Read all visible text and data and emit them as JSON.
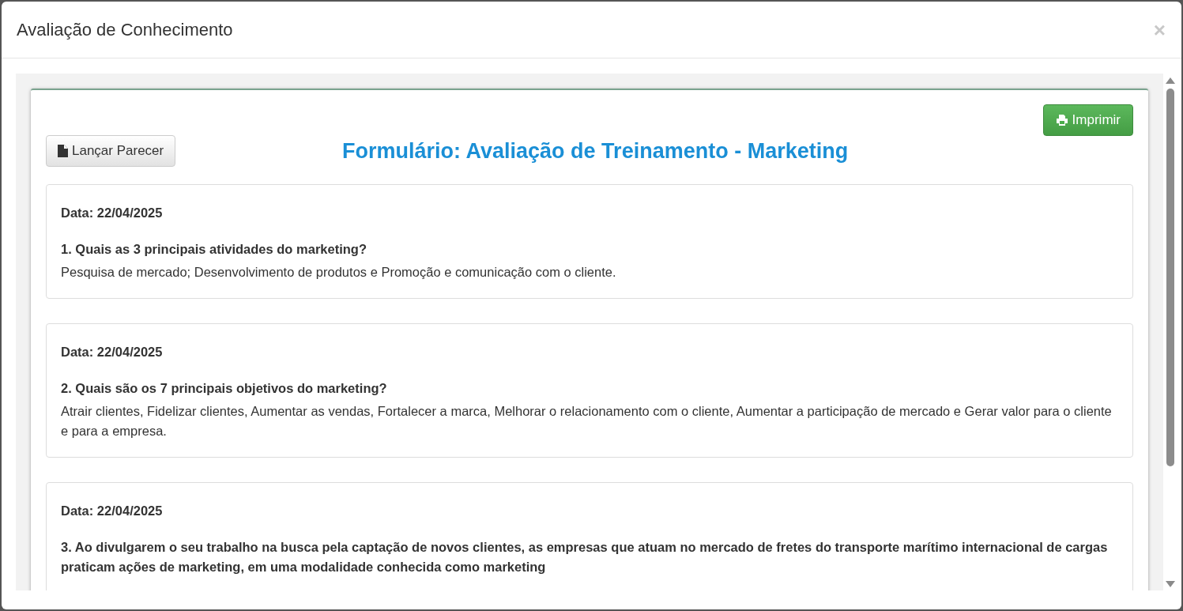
{
  "modal": {
    "title": "Avaliação de Conhecimento",
    "close": "×"
  },
  "actions": {
    "print_button": "Imprimir",
    "opinion_button": "Lançar Parecer"
  },
  "form_title": "Formulário: Avaliação de Treinamento - Marketing",
  "questions": [
    {
      "date": "Data: 22/04/2025",
      "question": "1. Quais as 3 principais atividades do marketing?",
      "answer": "Pesquisa de mercado; Desenvolvimento de produtos e Promoção e comunicação com o cliente."
    },
    {
      "date": "Data: 22/04/2025",
      "question": "2. Quais são os 7 principais objetivos do marketing?",
      "answer": "Atrair clientes, Fidelizar clientes, Aumentar as vendas, Fortalecer a marca, Melhorar o relacionamento com o cliente, Aumentar a participação de mercado e Gerar valor para o cliente e para a empresa."
    },
    {
      "date": "Data: 22/04/2025",
      "question": "3. Ao divulgarem o seu trabalho na busca pela captação de novos clientes, as empresas que atuam no mercado de fretes do transporte marítimo internacional de cargas praticam ações de marketing, em uma modalidade conhecida como marketing"
    }
  ]
}
